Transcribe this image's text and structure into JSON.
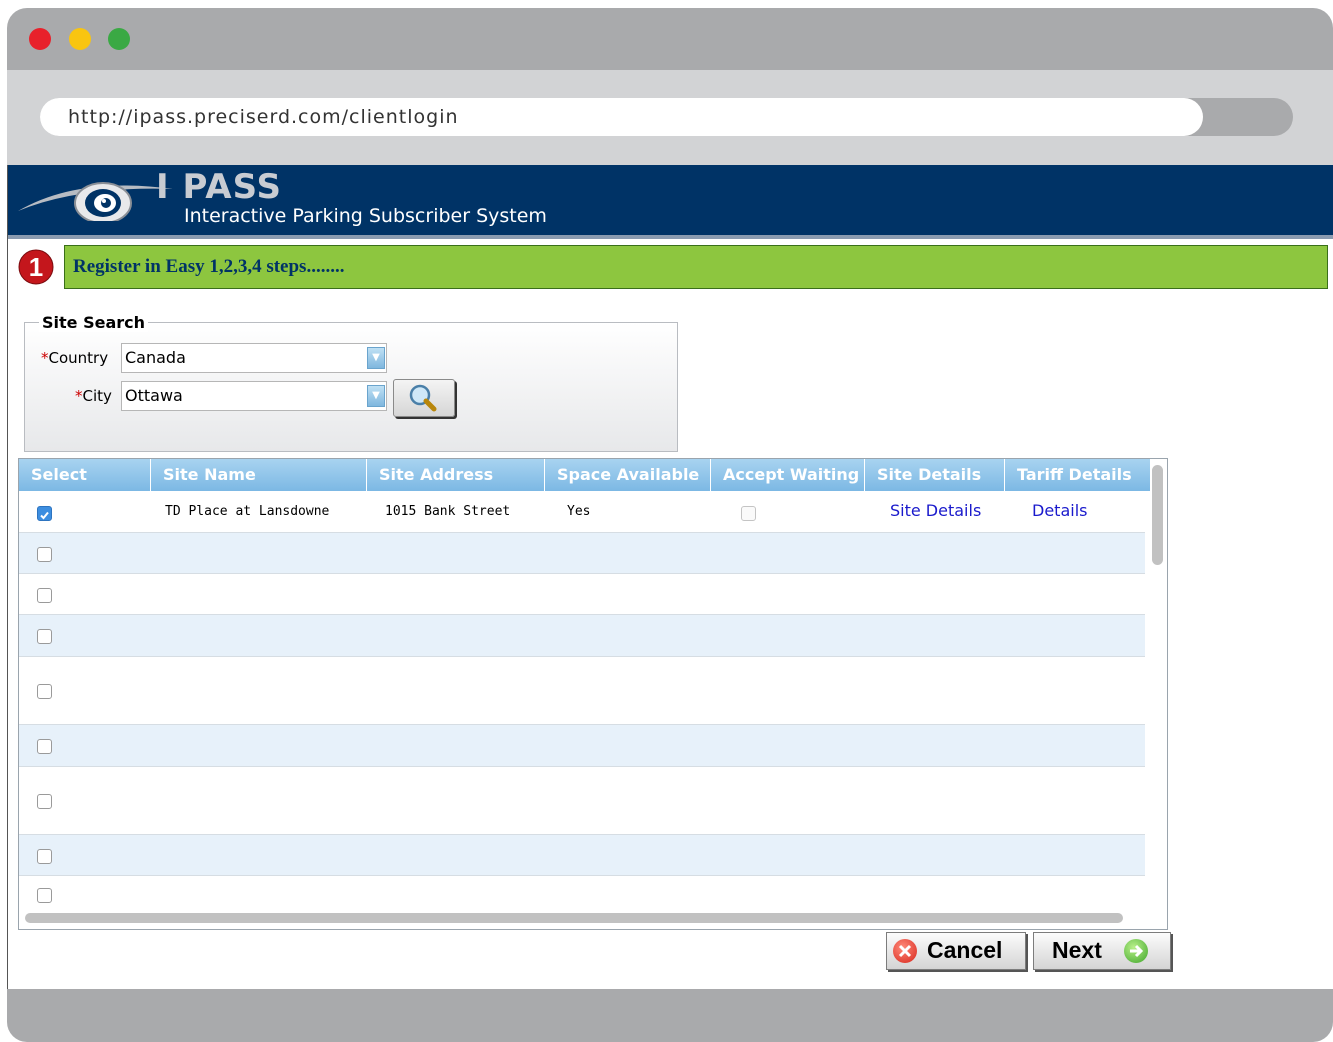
{
  "browser": {
    "url": "http://ipass.preciserd.com/clientlogin"
  },
  "header": {
    "logo_title": "I PASS",
    "logo_subtitle": "Interactive Parking Subscriber System"
  },
  "step": {
    "number": "1",
    "text": "Register in Easy 1,2,3,4 steps........"
  },
  "site_search": {
    "legend": "Site Search",
    "required_mark": "*",
    "country_label": "Country",
    "country_value": "Canada",
    "city_label": "City",
    "city_value": "Ottawa"
  },
  "grid": {
    "columns": [
      "Select",
      "Site Name",
      "Site Address",
      "Space Available",
      "Accept Waiting",
      "Site Details",
      "Tariff Details"
    ],
    "rows": [
      {
        "selected": true,
        "site_name": "TD Place at Lansdowne",
        "site_address": "1015 Bank Street",
        "space_available": "Yes",
        "accept_waiting": false,
        "site_details": "Site Details",
        "tariff_details": "Details"
      }
    ],
    "empty_rows": 9
  },
  "buttons": {
    "cancel": "Cancel",
    "next": "Next"
  },
  "colors": {
    "header_bg": "#003366",
    "step_bar": "#8dc63f",
    "grid_header": "#7cb8e4",
    "link": "#1a1acc"
  }
}
